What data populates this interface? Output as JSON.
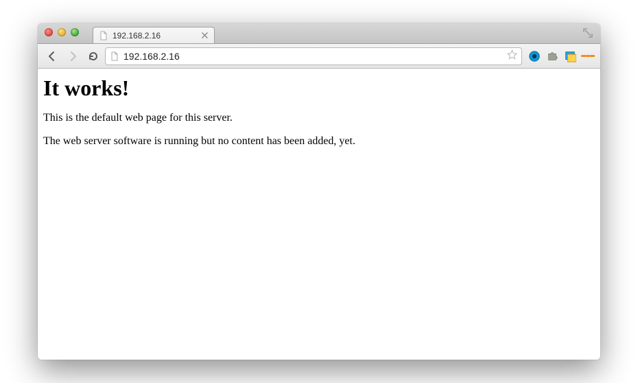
{
  "tab": {
    "title": "192.168.2.16"
  },
  "address_bar": {
    "url": "192.168.2.16"
  },
  "page": {
    "heading": "It works!",
    "paragraph1": "This is the default web page for this server.",
    "paragraph2": "The web server software is running but no content has been added, yet."
  }
}
